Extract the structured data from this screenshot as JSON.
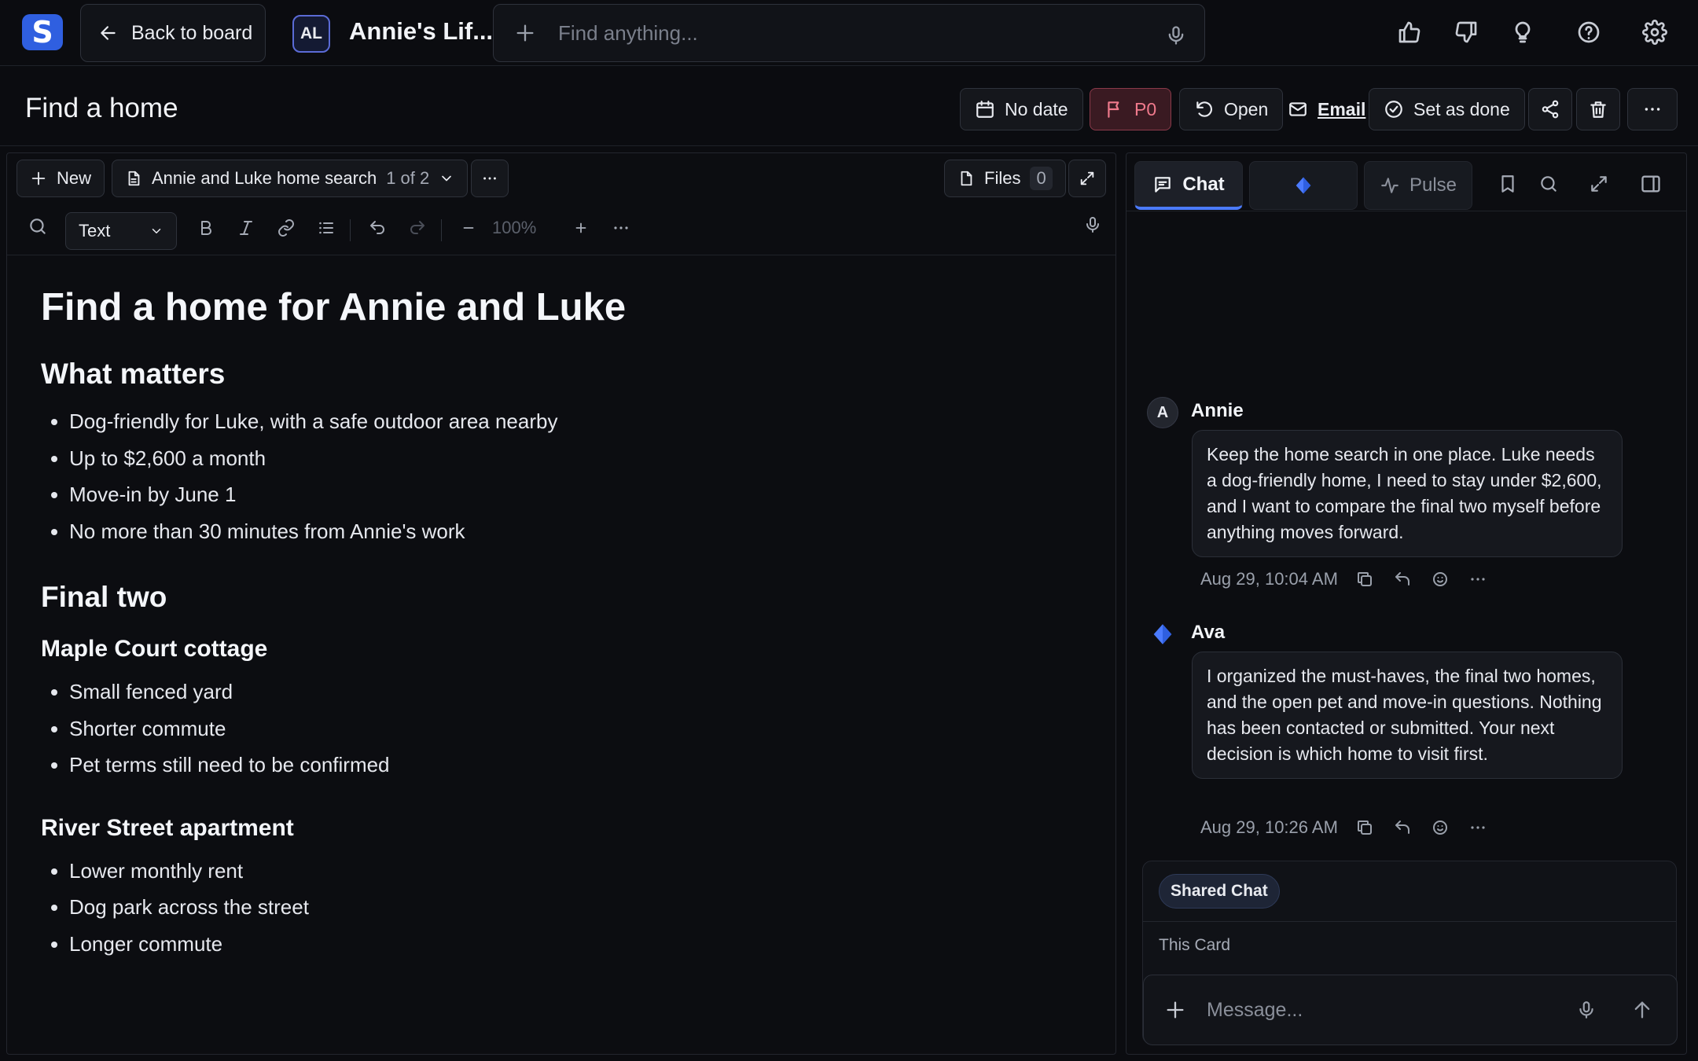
{
  "topbar": {
    "logo_letter": "S",
    "back_label": "Back to board",
    "workspace_initials": "AL",
    "workspace_title": "Annie's Lif...",
    "search_placeholder": "Find anything...",
    "icons": [
      "thumbs-up-icon",
      "thumbs-down-icon",
      "lightbulb-icon",
      "help-icon",
      "settings-icon"
    ]
  },
  "card": {
    "title": "Find a home",
    "date_label": "No date",
    "priority_label": "P0",
    "status_label": "Open",
    "email_label": "Email",
    "done_label": "Set as done"
  },
  "editor": {
    "new_label": "New",
    "doc_name": "Annie and Luke home search",
    "doc_counter": "1 of 2",
    "files_label": "Files",
    "files_count": "0",
    "style_value": "Text",
    "zoom_level": "100%"
  },
  "doc": {
    "title": "Find a home for Annie and Luke",
    "what_matters_heading": "What matters",
    "what_matters": [
      "Dog-friendly for Luke, with a safe outdoor area nearby",
      "Up to $2,600 a month",
      "Move-in by June 1",
      "No more than 30 minutes from Annie's work"
    ],
    "final_two_heading": "Final two",
    "maple_heading": "Maple Court cottage",
    "maple_items": [
      "Small fenced yard",
      "Shorter commute",
      "Pet terms still need to be confirmed"
    ],
    "river_heading": "River Street apartment",
    "river_items": [
      "Lower monthly rent",
      "Dog park across the street",
      "Longer commute"
    ]
  },
  "chat": {
    "tabs": {
      "chat": "Chat",
      "pulse": "Pulse"
    },
    "messages": [
      {
        "avatar": "A",
        "author": "Annie",
        "text": "Keep the home search in one place. Luke needs a dog-friendly home, I need to stay under $2,600, and I want to compare the final two myself before anything moves forward.",
        "time": "Aug 29, 10:04 AM"
      },
      {
        "author": "Ava",
        "text": "I organized the must-haves, the final two homes, and the open pet and move-in questions. Nothing has been contacted or submitted. Your next decision is which home to visit first.",
        "time": "Aug 29, 10:26 AM"
      }
    ],
    "shared_label": "Shared Chat",
    "scope_label": "This Card",
    "message_placeholder": "Message..."
  },
  "colors": {
    "accent": "#4b7bff",
    "logo_bg": "#2f5fe0",
    "priority": "#f07a8c",
    "background": "#0b0c10"
  }
}
